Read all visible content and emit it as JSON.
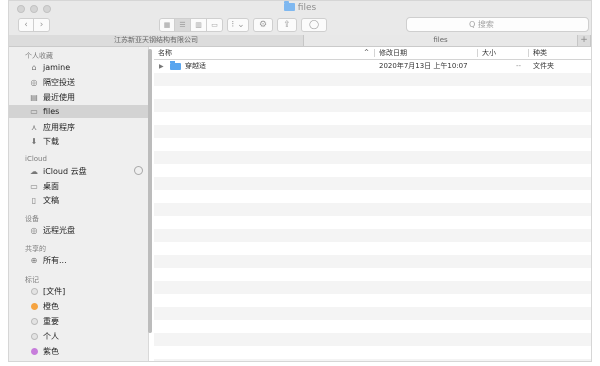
{
  "window": {
    "title": "files"
  },
  "toolbar": {
    "back": "‹",
    "forward": "›",
    "view_icons": "▦",
    "view_list": "☰",
    "view_columns": "▥",
    "view_gallery": "▭",
    "arrange": "⁝ ⌄",
    "action": "⚙ ⌄",
    "share": "⇪",
    "tag": "◯",
    "search_placeholder": "Q 搜索"
  },
  "tabs": {
    "tab1": "江苏新亚天钢结构有限公司",
    "tab2": "files",
    "plus": "+"
  },
  "sidebar": {
    "favorites_label": "个人收藏",
    "favorites": [
      {
        "label": "jamine",
        "icon": "⌂"
      },
      {
        "label": "隔空投送",
        "icon": "◎"
      },
      {
        "label": "最近使用",
        "icon": "▤"
      },
      {
        "label": "files",
        "icon": "▭"
      },
      {
        "label": "应用程序",
        "icon": "⋏"
      },
      {
        "label": "下载",
        "icon": "⬇"
      }
    ],
    "icloud_label": "iCloud",
    "icloud": [
      {
        "label": "iCloud 云盘",
        "icon": "☁"
      },
      {
        "label": "桌面",
        "icon": "▭"
      },
      {
        "label": "文稿",
        "icon": "▯"
      }
    ],
    "devices_label": "设备",
    "devices": [
      {
        "label": "远程光盘",
        "icon": "◎"
      }
    ],
    "shared_label": "共享的",
    "shared": [
      {
        "label": "所有...",
        "icon": "⊕"
      }
    ],
    "tags_label": "标记",
    "tags": [
      {
        "label": "[文件]",
        "color": "#e3e3e3"
      },
      {
        "label": "橙色",
        "color": "#f5a340"
      },
      {
        "label": "重要",
        "color": "#e3e3e3"
      },
      {
        "label": "个人",
        "color": "#e3e3e3"
      },
      {
        "label": "紫色",
        "color": "#c77ddb"
      }
    ]
  },
  "columns": {
    "name": "名称",
    "date": "修改日期",
    "size": "大小",
    "kind": "种类"
  },
  "files": [
    {
      "name": "穿越适",
      "date": "2020年7月13日 上午10:07",
      "size": "--",
      "kind": "文件夹"
    }
  ]
}
